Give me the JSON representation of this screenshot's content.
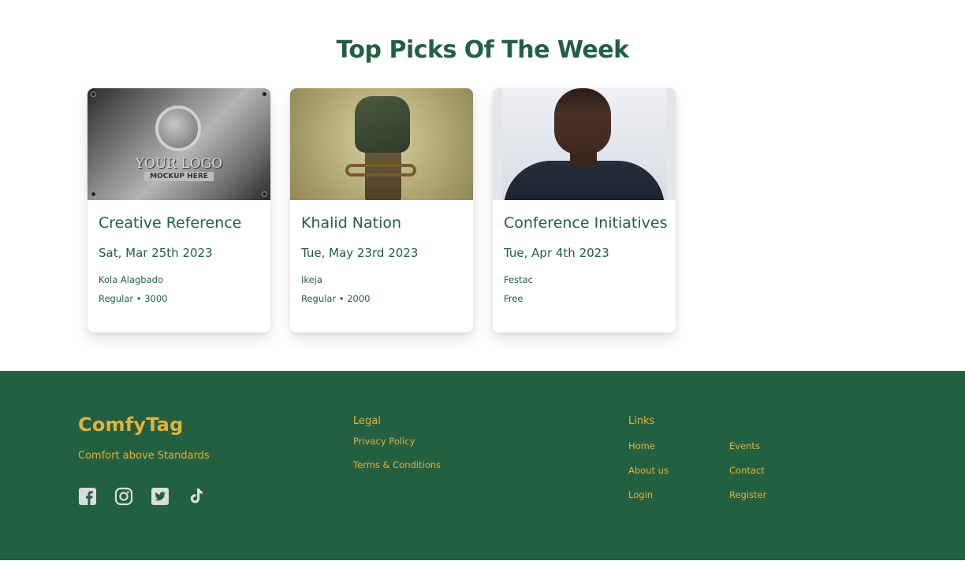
{
  "section": {
    "title": "Top Picks Of The Week"
  },
  "cards": [
    {
      "image_alt": "metal plate logo mockup",
      "image_text": "YOUR LOGO",
      "image_subtext": "MOCKUP HERE",
      "title": "Creative Reference",
      "date": "Sat, Mar 25th 2023",
      "location": "Kola Alagbado",
      "price": "Regular • 3000"
    },
    {
      "image_alt": "chained fist artwork",
      "title": "Khalid Nation",
      "date": "Tue, May 23rd 2023",
      "location": "Ikeja",
      "price": "Regular • 2000"
    },
    {
      "image_alt": "portrait photo",
      "title": "Conference Initiatives",
      "date": "Tue, Apr 4th 2023",
      "location": "Festac",
      "price": "Free"
    }
  ],
  "footer": {
    "brand": "ComfyTag",
    "tagline": "Comfort above Standards",
    "socials": [
      "facebook-icon",
      "instagram-icon",
      "twitter-icon",
      "tiktok-icon"
    ],
    "legal": {
      "heading": "Legal",
      "links": [
        "Privacy Policy",
        "Terms & Conditions"
      ]
    },
    "links": {
      "heading": "Links",
      "col1": [
        "Home",
        "About us",
        "Login"
      ],
      "col2": [
        "Events",
        "Contact",
        "Register"
      ]
    }
  },
  "colors": {
    "primary_green": "#22603f",
    "footer_bg": "#236042",
    "accent_gold": "#e1b23c"
  }
}
